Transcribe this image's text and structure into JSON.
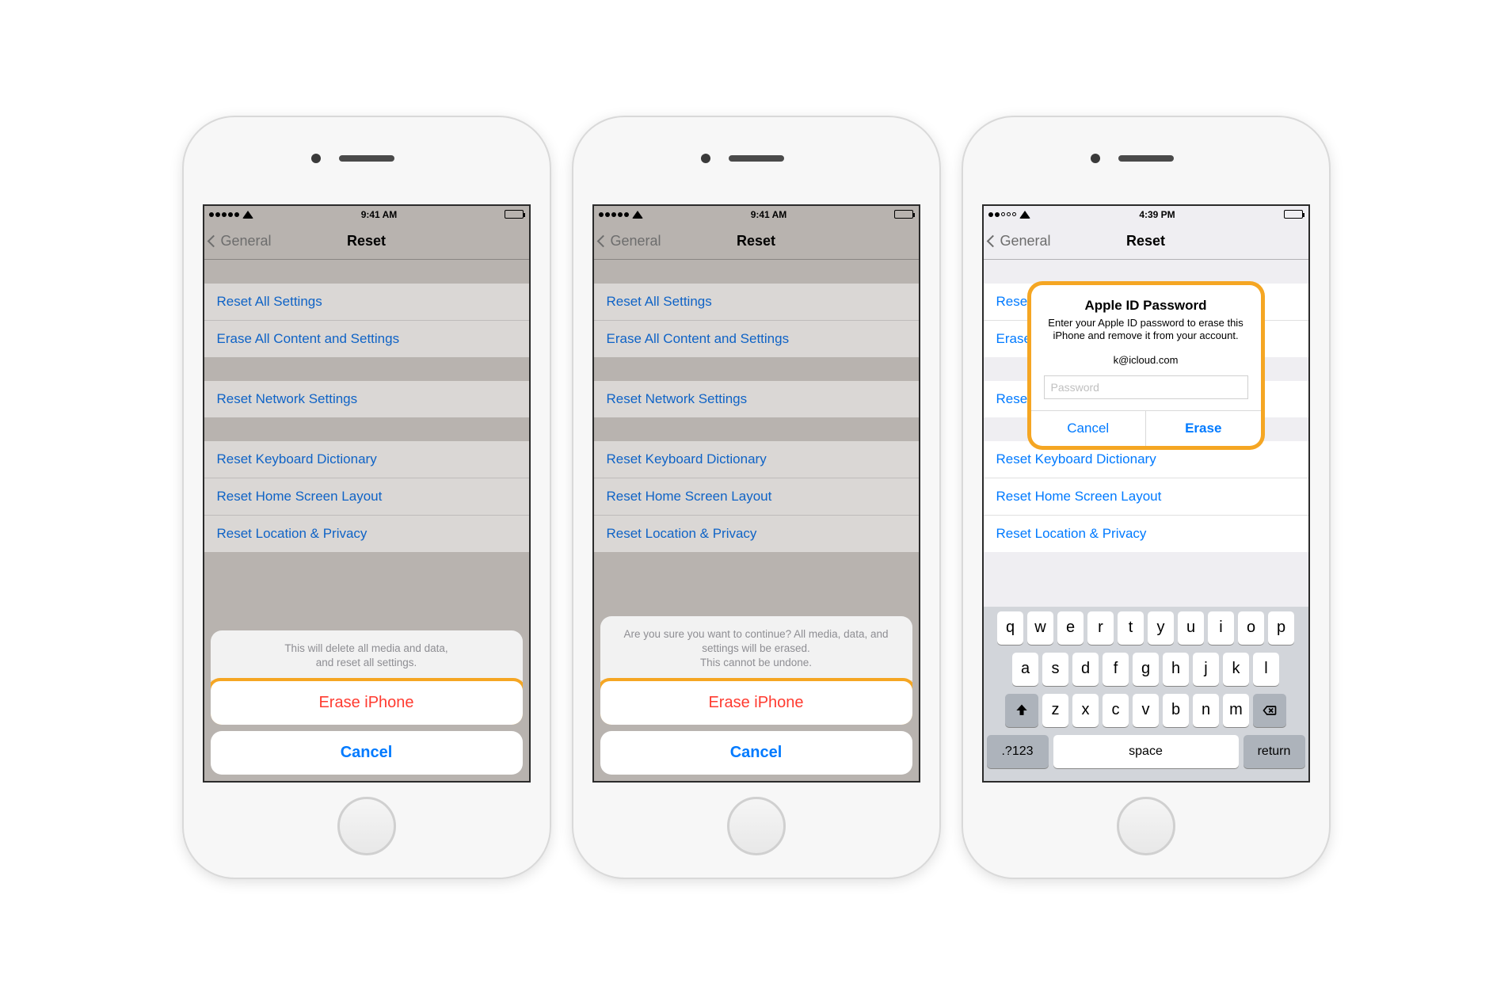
{
  "status": {
    "time1": "9:41 AM",
    "time2": "9:41 AM",
    "time3": "4:39 PM"
  },
  "nav": {
    "back": "General",
    "title": "Reset"
  },
  "reset_items": {
    "g1": [
      "Reset All Settings",
      "Erase All Content and Settings"
    ],
    "g2": [
      "Reset Network Settings"
    ],
    "g3": [
      "Reset Keyboard Dictionary",
      "Reset Home Screen Layout",
      "Reset Location & Privacy"
    ]
  },
  "sheet1": {
    "msg": "This will delete all media and data,\nand reset all settings.",
    "erase": "Erase iPhone",
    "cancel": "Cancel"
  },
  "sheet2": {
    "msg": "Are you sure you want to continue? All media, data, and settings will be erased.\nThis cannot be undone.",
    "erase": "Erase iPhone",
    "cancel": "Cancel"
  },
  "alert": {
    "title": "Apple ID Password",
    "body": "Enter your Apple ID password to erase this iPhone and remove it from your account.",
    "email": "k@icloud.com",
    "placeholder": "Password",
    "cancel": "Cancel",
    "erase": "Erase"
  },
  "kb": {
    "r1": [
      "q",
      "w",
      "e",
      "r",
      "t",
      "y",
      "u",
      "i",
      "o",
      "p"
    ],
    "r2": [
      "a",
      "s",
      "d",
      "f",
      "g",
      "h",
      "j",
      "k",
      "l"
    ],
    "r3": [
      "z",
      "x",
      "c",
      "v",
      "b",
      "n",
      "m"
    ],
    "symnum": ".?123",
    "space": "space",
    "return": "return"
  }
}
